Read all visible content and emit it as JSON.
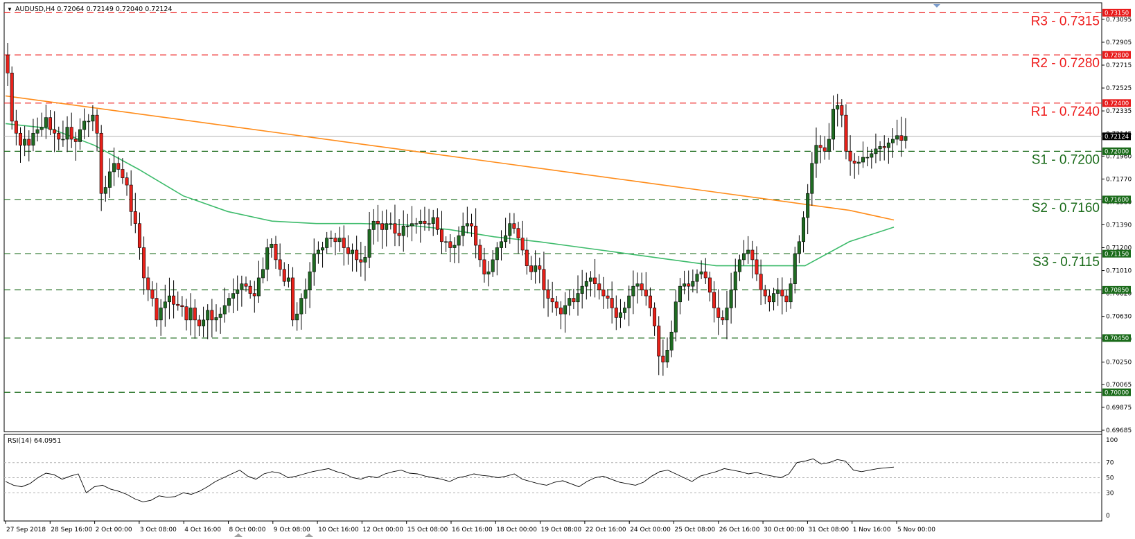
{
  "symbol_header": "AUDUSD,H4  0.72064 0.72149 0.72040 0.72124",
  "colors": {
    "bull": "#1f6b22",
    "bear": "#e8211a",
    "ma_short": "#3dbb6b",
    "ma_long": "#ff8c1a",
    "resistance": "#ee1c1c",
    "support": "#1a6b1a",
    "current": "#000000"
  },
  "chart_data": {
    "type": "candlestick",
    "ylim": [
      0.69685,
      0.73175
    ],
    "y_ticks": [
      "0.73095",
      "0.72905",
      "0.72715",
      "0.72525",
      "0.72335",
      "0.72145",
      "0.71960",
      "0.71770",
      "0.71580",
      "0.71390",
      "0.71200",
      "0.71010",
      "0.70820",
      "0.70630",
      "0.70440",
      "0.70250",
      "0.70065",
      "0.69875",
      "0.69685"
    ],
    "x_labels": [
      "27 Sep 2018",
      "28 Sep 16:00",
      "2 Oct 00:00",
      "3 Oct 08:00",
      "4 Oct 16:00",
      "8 Oct 00:00",
      "9 Oct 08:00",
      "10 Oct 16:00",
      "12 Oct 00:00",
      "15 Oct 08:00",
      "16 Oct 16:00",
      "18 Oct 00:00",
      "19 Oct 08:00",
      "22 Oct 16:00",
      "24 Oct 00:00",
      "25 Oct 08:00",
      "26 Oct 16:00",
      "30 Oct 00:00",
      "31 Oct 08:00",
      "1 Nov 16:00",
      "5 Nov 00:00"
    ],
    "current_price": "0.72124",
    "levels": [
      {
        "kind": "resistance",
        "price": 0.7315,
        "badge": "0.73150",
        "label": "R3 - 0.7315"
      },
      {
        "kind": "resistance",
        "price": 0.728,
        "badge": "0.72800",
        "label": "R2 - 0.7280"
      },
      {
        "kind": "resistance",
        "price": 0.724,
        "badge": "0.72400",
        "label": "R1 - 0.7240"
      },
      {
        "kind": "support",
        "price": 0.72,
        "badge": "0.72000",
        "label": "S1 - 0.7200"
      },
      {
        "kind": "support",
        "price": 0.716,
        "badge": "0.71600",
        "label": "S2 - 0.7160"
      },
      {
        "kind": "support",
        "price": 0.7115,
        "badge": "0.71150",
        "label": "S3 - 0.7115"
      },
      {
        "kind": "support",
        "price": 0.7085,
        "badge": "0.70850",
        "label": ""
      },
      {
        "kind": "support",
        "price": 0.7045,
        "badge": "0.70450",
        "label": ""
      },
      {
        "kind": "support",
        "price": 0.7,
        "badge": "0.70000",
        "label": ""
      }
    ],
    "close": [
      0.7265,
      0.7225,
      0.7215,
      0.7205,
      0.721,
      0.7205,
      0.7215,
      0.7218,
      0.722,
      0.7228,
      0.7218,
      0.7215,
      0.721,
      0.721,
      0.722,
      0.721,
      0.7208,
      0.7218,
      0.7225,
      0.7225,
      0.723,
      0.7215,
      0.7165,
      0.717,
      0.7183,
      0.719,
      0.7185,
      0.7178,
      0.7172,
      0.715,
      0.714,
      0.712,
      0.7095,
      0.7085,
      0.7078,
      0.706,
      0.707,
      0.7075,
      0.708,
      0.7073,
      0.7072,
      0.7071,
      0.706,
      0.707,
      0.706,
      0.7055,
      0.706,
      0.7068,
      0.706,
      0.7062,
      0.7065,
      0.7072,
      0.7078,
      0.7082,
      0.7085,
      0.709,
      0.7088,
      0.7082,
      0.708,
      0.7095,
      0.7102,
      0.712,
      0.7123,
      0.711,
      0.7102,
      0.7092,
      0.7095,
      0.706,
      0.7065,
      0.7078,
      0.7085,
      0.71,
      0.7115,
      0.7118,
      0.712,
      0.7128,
      0.7128,
      0.7125,
      0.7128,
      0.712,
      0.7115,
      0.7118,
      0.711,
      0.7108,
      0.7112,
      0.7135,
      0.7142,
      0.714,
      0.7135,
      0.714,
      0.714,
      0.7132,
      0.713,
      0.7138,
      0.7138,
      0.714,
      0.714,
      0.7142,
      0.714,
      0.714,
      0.7145,
      0.7135,
      0.7125,
      0.7125,
      0.712,
      0.7122,
      0.713,
      0.7138,
      0.714,
      0.7138,
      0.7122,
      0.711,
      0.7098,
      0.71,
      0.711,
      0.712,
      0.7125,
      0.713,
      0.714,
      0.7136,
      0.7128,
      0.7118,
      0.7105,
      0.71,
      0.7105,
      0.7102,
      0.7085,
      0.7078,
      0.7075,
      0.707,
      0.7065,
      0.7072,
      0.7078,
      0.7075,
      0.7082,
      0.7088,
      0.7092,
      0.7095,
      0.709,
      0.7085,
      0.708,
      0.7078,
      0.707,
      0.7062,
      0.7066,
      0.707,
      0.708,
      0.7088,
      0.709,
      0.7085,
      0.708,
      0.707,
      0.7055,
      0.703,
      0.7025,
      0.7035,
      0.705,
      0.7075,
      0.7088,
      0.709,
      0.7088,
      0.7092,
      0.7098,
      0.71,
      0.7095,
      0.7083,
      0.707,
      0.7062,
      0.706,
      0.707,
      0.7085,
      0.71,
      0.711,
      0.7115,
      0.7118,
      0.711,
      0.7098,
      0.7085,
      0.708,
      0.7075,
      0.7082,
      0.7085,
      0.708,
      0.7075,
      0.709,
      0.7115,
      0.7125,
      0.7145,
      0.7165,
      0.719,
      0.7205,
      0.7203,
      0.72,
      0.721,
      0.7235,
      0.7238,
      0.723,
      0.72,
      0.7192,
      0.719,
      0.7191,
      0.7195,
      0.7195,
      0.7198,
      0.7202,
      0.7204,
      0.7203,
      0.7207,
      0.721,
      0.7213,
      0.7209,
      0.72124
    ],
    "ma_long": [
      0.7246,
      0.7241,
      0.7236,
      0.7231,
      0.7226,
      0.7221,
      0.7216,
      0.7211,
      0.7206,
      0.7201,
      0.7196,
      0.7191,
      0.7186,
      0.7181,
      0.7176,
      0.7171,
      0.7166,
      0.7161,
      0.7156,
      0.7151,
      0.7143
    ],
    "ma_short": [
      0.7223,
      0.7219,
      0.7205,
      0.7185,
      0.7163,
      0.715,
      0.7142,
      0.714,
      0.714,
      0.7139,
      0.7135,
      0.7129,
      0.7125,
      0.712,
      0.7115,
      0.711,
      0.7105,
      0.7105,
      0.7105,
      0.7125,
      0.7137
    ],
    "rsi": {
      "label": "RSI(14) 64.0951",
      "ticks": [
        "100",
        "70",
        "50",
        "30",
        "0"
      ],
      "levels": [
        70,
        50,
        30
      ],
      "values": [
        45,
        40,
        38,
        42,
        50,
        56,
        54,
        48,
        52,
        55,
        30,
        38,
        40,
        35,
        32,
        28,
        22,
        18,
        20,
        26,
        24,
        25,
        30,
        28,
        32,
        38,
        45,
        50,
        55,
        60,
        52,
        48,
        55,
        58,
        56,
        50,
        52,
        55,
        58,
        60,
        62,
        58,
        55,
        50,
        48,
        52,
        50,
        55,
        58,
        60,
        56,
        55,
        52,
        50,
        48,
        45,
        50,
        52,
        55,
        53,
        52,
        50,
        52,
        55,
        48,
        45,
        42,
        40,
        44,
        46,
        42,
        38,
        45,
        50,
        52,
        48,
        44,
        42,
        40,
        44,
        52,
        58,
        60,
        55,
        50,
        45,
        52,
        55,
        58,
        62,
        60,
        58,
        55,
        57,
        54,
        52,
        50,
        55,
        70,
        72,
        75,
        68,
        70,
        74,
        72,
        60,
        58,
        60,
        62,
        63,
        64
      ]
    }
  }
}
